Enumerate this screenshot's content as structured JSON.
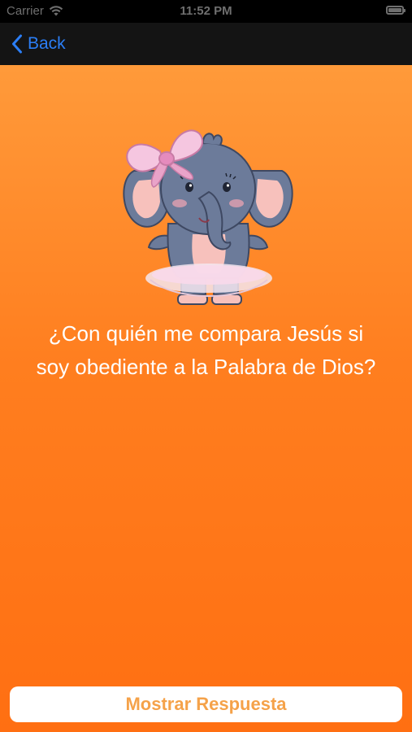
{
  "status_bar": {
    "carrier": "Carrier",
    "time": "11:52 PM",
    "icons": [
      "wifi-icon",
      "battery-icon"
    ]
  },
  "nav": {
    "back_label": "Back",
    "back_icon": "chevron-left-icon",
    "accent_color": "#2b7ef6"
  },
  "content": {
    "illustration": "elephant-ballerina-icon",
    "question": "¿Con quién me compara Jesús si\nsoy  obediente a la Palabra de Dios?",
    "background_color": "#ff7e1f"
  },
  "actions": {
    "show_answer_label": "Mostrar Respuesta",
    "show_answer_color": "#f5a249"
  }
}
